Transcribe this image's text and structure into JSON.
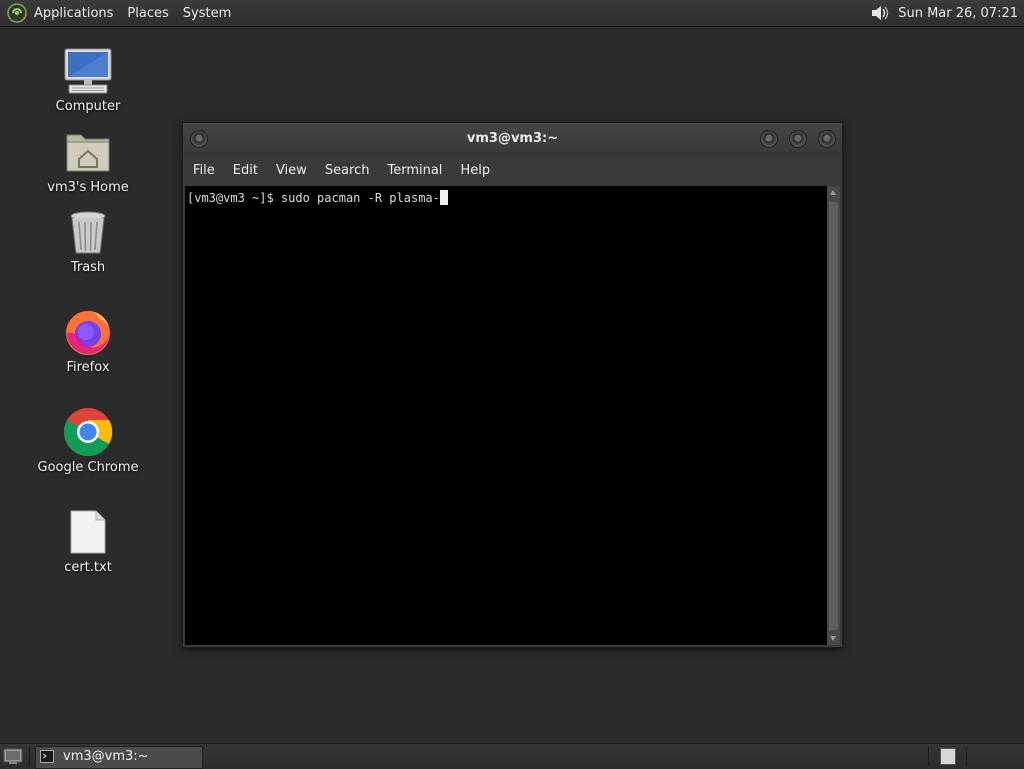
{
  "top_panel": {
    "menus": [
      "Applications",
      "Places",
      "System"
    ],
    "clock": "Sun Mar 26, 07:21"
  },
  "desktop_icons": [
    {
      "label": "Computer",
      "icon": "computer-icon"
    },
    {
      "label": "vm3's Home",
      "icon": "home-folder-icon"
    },
    {
      "label": "Trash",
      "icon": "trash-icon"
    },
    {
      "label": "Firefox",
      "icon": "firefox-icon"
    },
    {
      "label": "Google Chrome",
      "icon": "chrome-icon"
    },
    {
      "label": "cert.txt",
      "icon": "text-file-icon"
    }
  ],
  "terminal": {
    "title": "vm3@vm3:~",
    "menu": [
      "File",
      "Edit",
      "View",
      "Search",
      "Terminal",
      "Help"
    ],
    "prompt": "[vm3@vm3 ~]$ ",
    "command": "sudo pacman -R plasma-"
  },
  "taskbar": {
    "task_label": "vm3@vm3:~"
  },
  "colors": {
    "desktop_bg": "#2b2b2b",
    "terminal_bg": "#000000",
    "terminal_fg": "#dcdcdc"
  }
}
